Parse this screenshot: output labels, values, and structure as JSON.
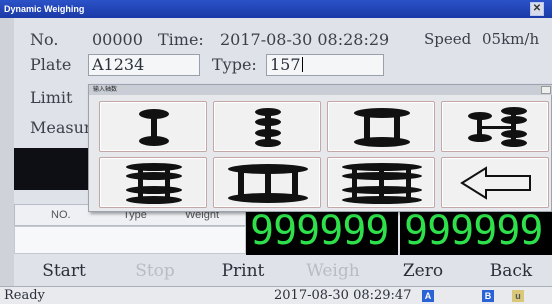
{
  "window": {
    "title": "Dynamic Weighing"
  },
  "form": {
    "no_label": "No.",
    "no_value": "00000",
    "time_label": "Time:",
    "time_value": "2017-08-30 08:28:29",
    "speed_label": "Speed",
    "speed_value": "05km/h",
    "plate_label": "Plate",
    "plate_value": "A1234",
    "type_label": "Type:",
    "type_value": "157",
    "limit_label": "Limit",
    "measure_label": "Measur"
  },
  "grid": {
    "col_no": "NO.",
    "col_type": "Type",
    "col_weight": "Weight"
  },
  "display": {
    "total_weight": "999999",
    "axle_weight": "999999"
  },
  "colors": {
    "display_bg": "#000000",
    "display_digits": "#2ee04a",
    "titlebar": "#2447b8"
  },
  "dialog": {
    "title": "输入轴数",
    "options": [
      {
        "name": "axle-option-1",
        "icon": "single-axle-icon"
      },
      {
        "name": "axle-option-2",
        "icon": "tandem-axle-icon"
      },
      {
        "name": "axle-option-3",
        "icon": "two-single-axles-icon"
      },
      {
        "name": "axle-option-4",
        "icon": "single-plus-tandem-axle-icon"
      },
      {
        "name": "axle-option-5",
        "icon": "double-tandem-axle-icon"
      },
      {
        "name": "axle-option-6",
        "icon": "three-single-axles-icon"
      },
      {
        "name": "axle-option-7",
        "icon": "triple-tandem-axle-icon"
      },
      {
        "name": "backspace",
        "icon": "left-arrow-icon"
      }
    ]
  },
  "buttons": {
    "start": "Start",
    "stop": "Stop",
    "print": "Print",
    "weigh": "Weigh",
    "zero": "Zero",
    "back": "Back"
  },
  "status": {
    "text": "Ready",
    "time": "2017-08-30 08:29:47"
  }
}
